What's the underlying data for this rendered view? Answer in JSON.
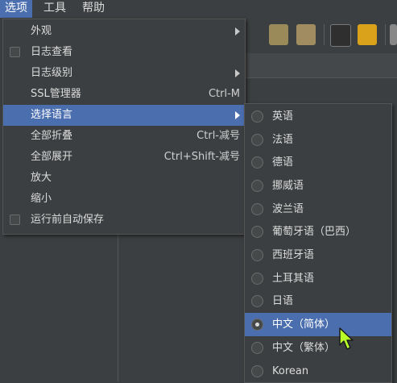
{
  "menubar": {
    "options": "选项",
    "tools": "工具",
    "help": "帮助"
  },
  "options_menu": {
    "items": [
      {
        "label": "外观",
        "submenu": true
      },
      {
        "label": "日志查看",
        "checkbox": true
      },
      {
        "label": "日志级别",
        "submenu": true
      },
      {
        "label": "SSL管理器",
        "accel": "Ctrl-M"
      },
      {
        "label": "选择语言",
        "submenu": true,
        "selected": true
      },
      {
        "label": "全部折叠",
        "accel": "Ctrl-减号"
      },
      {
        "label": "全部展开",
        "accel": "Ctrl+Shift-减号"
      },
      {
        "label": "放大"
      },
      {
        "label": "缩小"
      },
      {
        "label": "运行前自动保存",
        "checkbox": true
      }
    ]
  },
  "language_menu": {
    "items": [
      {
        "label": "英语"
      },
      {
        "label": "法语"
      },
      {
        "label": "德语"
      },
      {
        "label": "挪威语"
      },
      {
        "label": "波兰语"
      },
      {
        "label": "葡萄牙语（巴西）"
      },
      {
        "label": "西班牙语"
      },
      {
        "label": "土耳其语"
      },
      {
        "label": "日语"
      },
      {
        "label": "中文（简体）",
        "checked": true
      },
      {
        "label": "中文（繁体）"
      },
      {
        "label": "Korean"
      }
    ]
  },
  "colors": {
    "highlight": "#4b6eaf",
    "background": "#3c3f41",
    "text": "#dcdcdc",
    "cursor": "#b8ff2a"
  }
}
